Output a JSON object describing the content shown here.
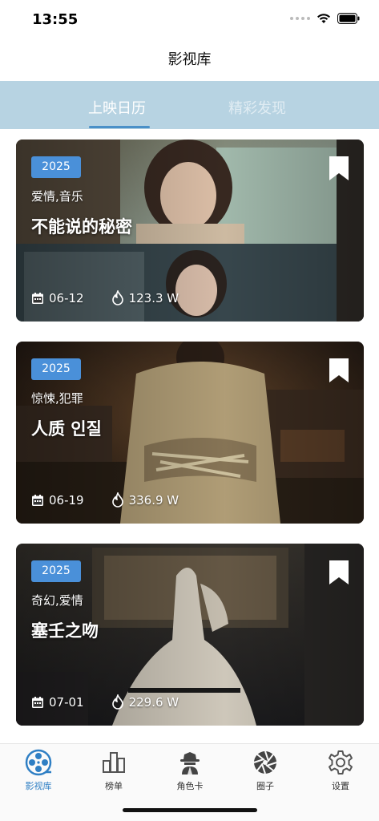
{
  "status_bar": {
    "time": "13:55"
  },
  "nav": {
    "title": "影视库"
  },
  "tabs": [
    {
      "label": "上映日历",
      "active": true
    },
    {
      "label": "精彩发现",
      "active": false
    }
  ],
  "movies": [
    {
      "year": "2025",
      "genre": "爱情,音乐",
      "title": "不能说的秘密",
      "date": "06-12",
      "hot": "123.3 W"
    },
    {
      "year": "2025",
      "genre": "惊悚,犯罪",
      "title": "人质 인질",
      "date": "06-19",
      "hot": "336.9 W"
    },
    {
      "year": "2025",
      "genre": "奇幻,爱情",
      "title": "塞壬之吻",
      "date": "07-01",
      "hot": "229.6 W"
    }
  ],
  "bottom_nav": [
    {
      "label": "影视库",
      "icon": "film-reel-icon",
      "active": true
    },
    {
      "label": "榜单",
      "icon": "chart-icon",
      "active": false
    },
    {
      "label": "角色卡",
      "icon": "detective-icon",
      "active": false
    },
    {
      "label": "圈子",
      "icon": "aperture-icon",
      "active": false
    },
    {
      "label": "设置",
      "icon": "gear-icon",
      "active": false
    }
  ],
  "colors": {
    "accent": "#4a90d9",
    "tab_bar": "#b7d3e2",
    "active_nav": "#2f7fc4"
  }
}
